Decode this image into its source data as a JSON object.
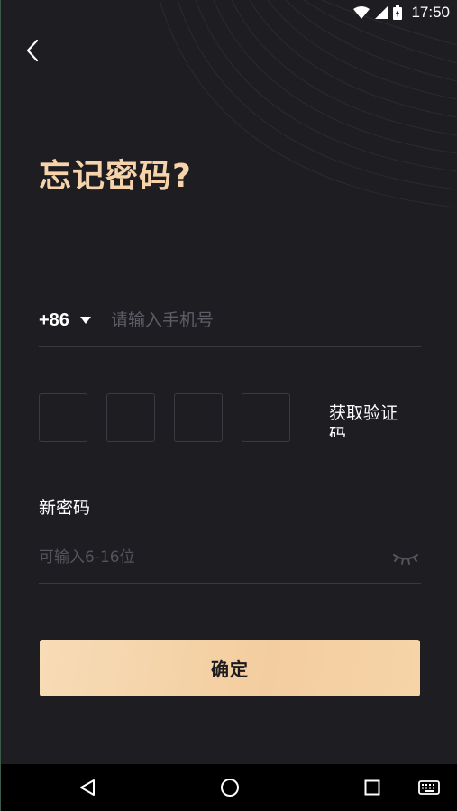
{
  "status_bar": {
    "time": "17:50",
    "icons": [
      "wifi-icon",
      "signal-icon",
      "battery-icon"
    ]
  },
  "header": {
    "back_icon": "chevron-left-icon"
  },
  "title": "忘记密码?",
  "phone": {
    "country_code": "+86",
    "placeholder": "请输入手机号",
    "value": ""
  },
  "verification": {
    "box_count": 4,
    "get_code_label": "获取验证码"
  },
  "password": {
    "label": "新密码",
    "placeholder": "可输入6-16位",
    "value": "",
    "toggle_icon": "eye-closed-icon"
  },
  "confirm_label": "确定",
  "nav_bar": {
    "buttons": [
      "back-triangle-icon",
      "home-circle-icon",
      "recents-square-icon",
      "keyboard-icon"
    ]
  },
  "colors": {
    "background": "#1e1d22",
    "accent": "#f6d3ab",
    "button": "#f3cd9f"
  }
}
